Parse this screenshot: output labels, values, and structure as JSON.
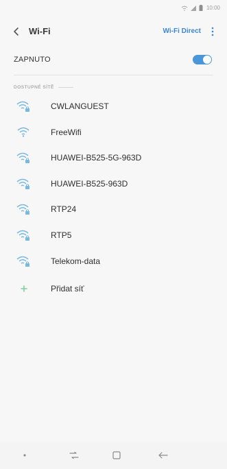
{
  "status_bar": {
    "time": "10:00",
    "icons": [
      "wifi-calling-icon",
      "signal-icon",
      "battery-icon"
    ]
  },
  "app_bar": {
    "title": "Wi-Fi",
    "wifi_direct": "Wi-Fi Direct",
    "icons": [
      "back-icon",
      "more-options-icon"
    ]
  },
  "wifi_toggle": {
    "label": "ZAPNUTO",
    "state": "on",
    "accent": "#4a96d8"
  },
  "networks_section": {
    "title": "DOSTUPNÉ SÍTĚ"
  },
  "networks": [
    {
      "name": "CWLANGUEST",
      "secured": true
    },
    {
      "name": "FreeWifi",
      "secured": false
    },
    {
      "name": "HUAWEI-B525-5G-963D",
      "secured": true
    },
    {
      "name": "HUAWEI-B525-963D",
      "secured": true
    },
    {
      "name": "RTP24",
      "secured": true
    },
    {
      "name": "RTP5",
      "secured": true
    },
    {
      "name": "Telekom-data",
      "secured": true
    }
  ],
  "add_network": {
    "label": "Přidat síť"
  },
  "nav_bar": {
    "icons": [
      "dot-icon",
      "recent-apps-icon",
      "home-icon",
      "back-arrow-icon"
    ]
  },
  "colors": {
    "link": "#3e86c9",
    "wifi_icon": "#7ab8de",
    "plus": "#7fcf9a"
  }
}
